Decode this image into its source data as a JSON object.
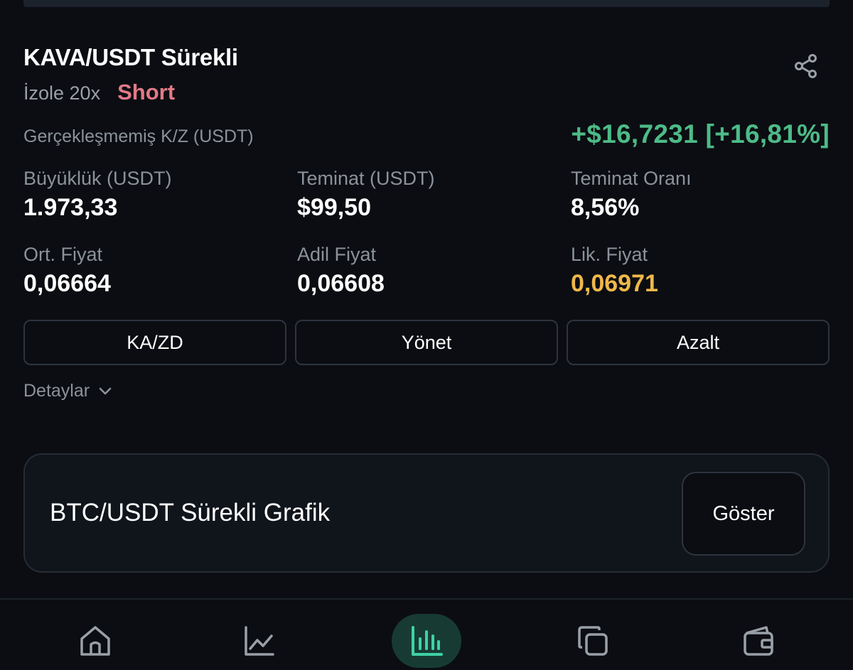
{
  "position": {
    "pair": "KAVA/USDT Sürekli",
    "margin_mode": "İzole 20x",
    "side": "Short",
    "pnl_label": "Gerçekleşmemiş K/Z (USDT)",
    "pnl_value": "+$16,7231 [+16,81%]",
    "metrics": [
      {
        "label": "Büyüklük (USDT)",
        "value": "1.973,33"
      },
      {
        "label": "Teminat (USDT)",
        "value": "$99,50"
      },
      {
        "label": "Teminat Oranı",
        "value": "8,56%"
      },
      {
        "label": "Ort. Fiyat",
        "value": "0,06664"
      },
      {
        "label": "Adil Fiyat",
        "value": "0,06608"
      },
      {
        "label": "Lik. Fiyat",
        "value": "0,06971"
      }
    ],
    "actions": {
      "tpsl": "KA/ZD",
      "manage": "Yönet",
      "reduce": "Azalt"
    },
    "details_label": "Detaylar"
  },
  "chart_card": {
    "title": "BTC/USDT Sürekli Grafik",
    "show_label": "Göster"
  },
  "icons": {
    "share": "share-icon",
    "details": "chevron-down-icon",
    "nav": [
      "home-icon",
      "market-chart-icon",
      "trade-bars-icon",
      "copy-icon",
      "wallet-icon"
    ]
  },
  "colors": {
    "background": "#0b0d12",
    "profit_green": "#4dbb87",
    "short_red": "#e07a86",
    "liquidation_yellow": "#f0b84a",
    "nav_active_bg": "#173b33",
    "nav_active_icon": "#3fd1a6"
  }
}
